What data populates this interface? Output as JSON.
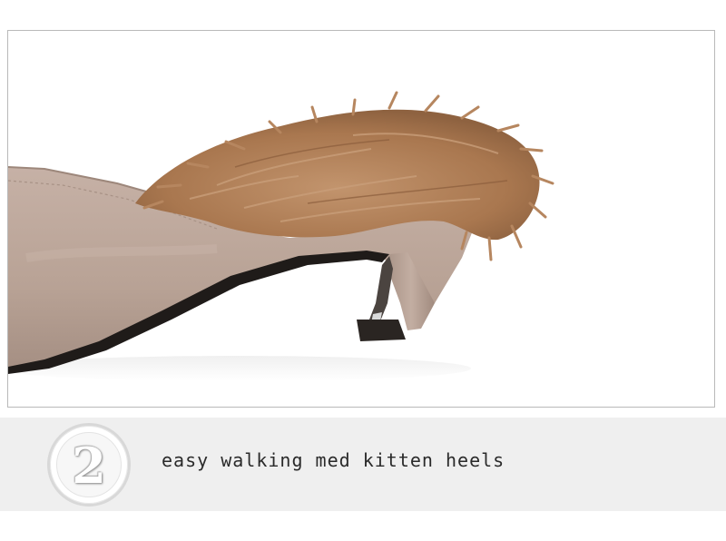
{
  "step": {
    "number": "2"
  },
  "caption": {
    "text": "easy walking med kitten heels"
  },
  "photo": {
    "subject": "suede mule with fur strap and kitten heel",
    "colors": {
      "suede": "#b9a397",
      "fur": "#b07e59",
      "heel_tip": "#2a2522",
      "band": "#efefef"
    }
  }
}
